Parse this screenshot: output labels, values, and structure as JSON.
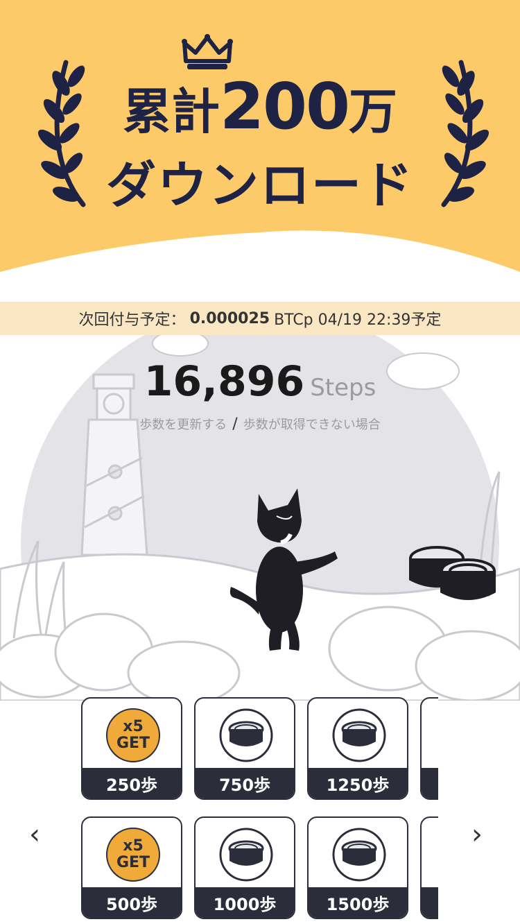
{
  "banner": {
    "headline_prefix": "累計",
    "headline_number": "200",
    "headline_suffix": "万",
    "headline_line2": "ダウンロード",
    "colors": {
      "background": "#fdca6a",
      "text": "#1e2346"
    }
  },
  "next_grant": {
    "label": "次回付与予定：",
    "amount": "0.000025",
    "unit_date": "BTCp 04/19 22:39予定"
  },
  "steps": {
    "count": "16,896",
    "unit": "Steps",
    "update_link": "歩数を更新する",
    "separator": "/",
    "help_link": "歩数が取得できない場合"
  },
  "rewards": {
    "row1": [
      {
        "type": "badge",
        "badge_top": "x5",
        "badge_bottom": "GET",
        "steps_label": "250歩"
      },
      {
        "type": "can",
        "icon": "cat-food-can-icon",
        "steps_label": "750歩"
      },
      {
        "type": "can",
        "icon": "cat-food-can-icon",
        "steps_label": "1250歩"
      }
    ],
    "row2": [
      {
        "type": "badge",
        "badge_top": "x5",
        "badge_bottom": "GET",
        "steps_label": "500歩"
      },
      {
        "type": "can",
        "icon": "cat-food-can-icon",
        "steps_label": "1000歩"
      },
      {
        "type": "can",
        "icon": "cat-food-can-icon",
        "steps_label": "1500歩"
      }
    ]
  },
  "nav": {
    "prev": "‹",
    "next": "›"
  }
}
